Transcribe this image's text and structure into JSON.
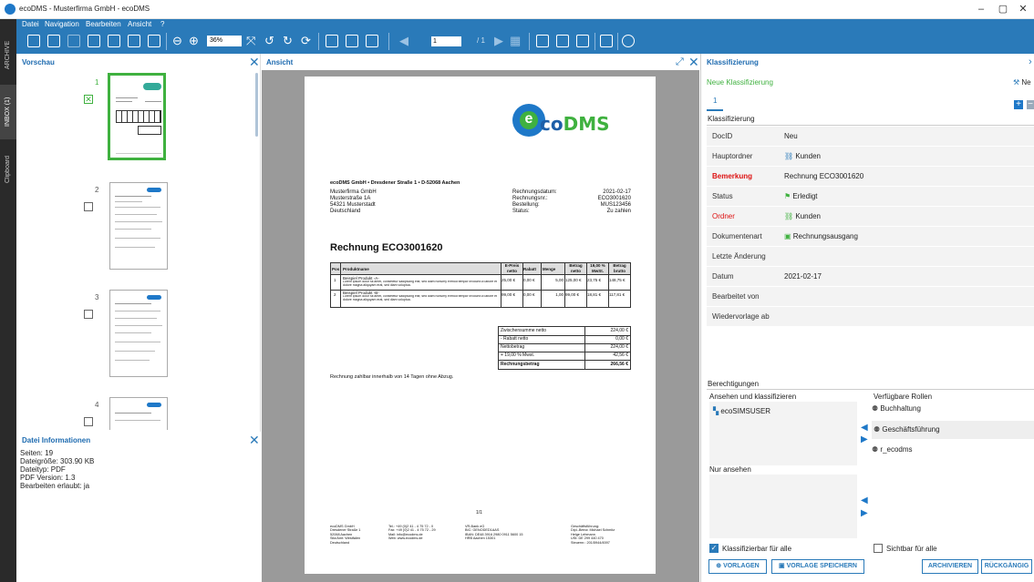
{
  "window": {
    "title": "ecoDMS - Musterfirma GmbH - ecoDMS",
    "minimize": "–",
    "maximize": "▢",
    "close": "✕"
  },
  "menu": [
    "Datei",
    "Navigation",
    "Bearbeiten",
    "Ansicht",
    "?"
  ],
  "toolbar": {
    "zoom": "36%",
    "page_input": "1",
    "page_total": "/ 1"
  },
  "sidetabs": [
    "ARCHIVE",
    "INBOX (1)",
    "Clipboard"
  ],
  "preview": {
    "title": "Vorschau",
    "pages": [
      "1",
      "2",
      "3",
      "4"
    ]
  },
  "file_info": {
    "title": "Datei Informationen",
    "lines": [
      "Seiten: 19",
      "Dateigröße: 303.90 KB",
      "Dateityp: PDF",
      "PDF Version: 1.3",
      "Bearbeiten erlaubt: ja"
    ]
  },
  "view": {
    "title": "Ansicht"
  },
  "document": {
    "sender_line": "ecoDMS GmbH • Dresdener Straße 1 • D-52068 Aachen",
    "address": [
      "Musterfirma GmbH",
      "Musterstraße 1A",
      "54321 Musterstadt",
      "Deutschland"
    ],
    "meta_labels": [
      "Rechnungsdatum:",
      "Rechnungsnr.:",
      "Bestellung:",
      "Status:"
    ],
    "meta_values": [
      "2021-02-17",
      "ECO3001620",
      "MUS123456",
      "Zu zahlen"
    ],
    "heading": "Rechnung ECO3001620",
    "table_headers": [
      "Pos",
      "Produktname",
      "E-Preis netto",
      "Rabatt",
      "Menge",
      "Betrag netto",
      "19,00 % MwSt.",
      "Betrag brutto"
    ],
    "rows": [
      [
        "1",
        "Beispiel Produkt -A-",
        "25,00 €",
        "0,00 €",
        "5,00",
        "125,00 €",
        "23,75 €",
        "148,75 €"
      ],
      [
        "2",
        "Beispiel Produkt -B-",
        "99,00 €",
        "0,00 €",
        "1,00",
        "99,00 €",
        "18,81 €",
        "117,81 €"
      ]
    ],
    "row_desc": "Lorem ipsum dolor sit amet, consetetur sadipscing elitr, sed diam nonumy eirmod tempor invidunt ut labore et dolore magna aliquyam erat, sed diam voluptua.",
    "totals": [
      [
        "Zwischensumme netto",
        "224,00 €"
      ],
      [
        "- Rabatt netto",
        "0,00 €"
      ],
      [
        "Nettobetrag",
        "224,00 €"
      ],
      [
        "+ 19,00 % Mwst.",
        "42,56 €"
      ],
      [
        "Rechnungsbetrag",
        "266,56 €"
      ]
    ],
    "note": "Rechnung zahlbar innerhalb von 14 Tagen ohne Abzug.",
    "page_label": "1/1",
    "footer": [
      "ecoDMS GmbH\nDresdener Straße 1\n52068 Aachen\nSitz/Amt: Westfalen\nDeutschland",
      "Tel.: +49 (0)2 41 - 4 75 72 - 0\nFax: +49 (0)2 41 - 4 75 72 - 29\nMail: info@ecodms.de\nWeb: www.ecodms.de",
      "VR-Bank eG\nBIC: GENODED1AAS\nIBAN: DE48 3916 2980 0911 5600 15\nHRB Aachen 15301",
      "Geschäftsführung:\nDipl.-Betrw. Michael Schmitz\nHelge Lehmann\nUSt: DE 299 440 470\nSteuernr.: 201/5944/4597"
    ]
  },
  "classification": {
    "title": "Klassifizierung",
    "new_label": "Neue Klassifizierung",
    "new_button": "Ne",
    "tab": "1",
    "section": "Klassifizierung",
    "fields": [
      {
        "label": "DocID",
        "value": "Neu"
      },
      {
        "label": "Hauptordner",
        "value": "Kunden"
      },
      {
        "label": "Bemerkung",
        "value": "Rechnung ECO3001620"
      },
      {
        "label": "Status",
        "value": "Erledigt"
      },
      {
        "label": "Ordner",
        "value": "Kunden"
      },
      {
        "label": "Dokumentenart",
        "value": "Rechnungsausgang"
      },
      {
        "label": "Letzte Änderung",
        "value": ""
      },
      {
        "label": "Datum",
        "value": "2021-02-17"
      },
      {
        "label": "Bearbeitet von",
        "value": ""
      },
      {
        "label": "Wiedervorlage ab",
        "value": ""
      }
    ]
  },
  "permissions": {
    "title": "Berechtigungen",
    "view_classify": "Ansehen und klassifizieren",
    "available_roles": "Verfügbare Rollen",
    "view_users": [
      "ecoSIMSUSER"
    ],
    "roles": [
      "Buchhaltung",
      "Geschäftsführung",
      "r_ecodms"
    ],
    "view_only": "Nur ansehen",
    "classifiable_all": "Klassifizierbar für alle",
    "visible_all": "Sichtbar für alle"
  },
  "buttons": {
    "templates": "VORLAGEN",
    "save_template": "VORLAGE SPEICHERN",
    "archive": "ARCHIVIEREN",
    "undo": "RÜCKGÄNGIG"
  },
  "colors": {
    "accent": "#2a7ab9",
    "green": "#3fb13f",
    "red": "#dd1111"
  }
}
